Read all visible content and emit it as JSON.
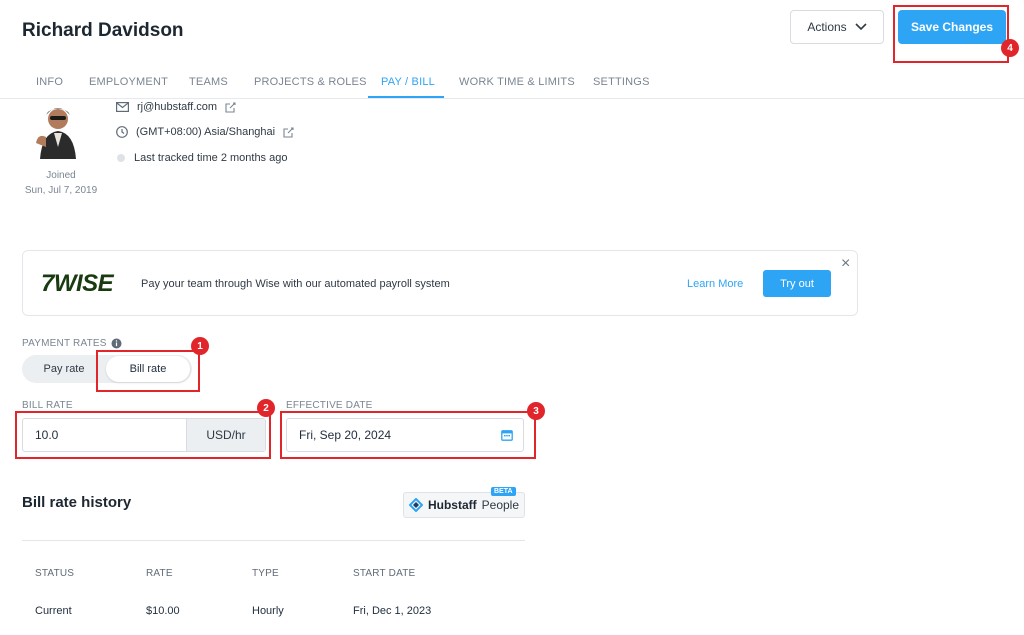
{
  "header": {
    "title": "Richard Davidson",
    "actions_label": "Actions",
    "save_label": "Save Changes"
  },
  "tabs": [
    {
      "label": "INFO"
    },
    {
      "label": "EMPLOYMENT"
    },
    {
      "label": "TEAMS"
    },
    {
      "label": "PROJECTS & ROLES"
    },
    {
      "label": "PAY / BILL",
      "active": true
    },
    {
      "label": "WORK TIME & LIMITS"
    },
    {
      "label": "SETTINGS"
    }
  ],
  "profile": {
    "email": "rj@hubstaff.com",
    "timezone": "(GMT+08:00) Asia/Shanghai",
    "last_tracked": "Last tracked time 2 months ago",
    "joined_label": "Joined",
    "joined_date": "Sun, Jul 7, 2019"
  },
  "wise_banner": {
    "logo": "7WISE",
    "text": "Pay your team through Wise with our automated payroll system",
    "learn_more": "Learn More",
    "try_out": "Try out",
    "close": "×"
  },
  "payment": {
    "section_label": "PAYMENT RATES",
    "pay_rate_label": "Pay rate",
    "bill_rate_label": "Bill rate",
    "bill_rate_field_label": "BILL RATE",
    "bill_rate_value": "10.0",
    "unit": "USD/hr",
    "effective_date_label": "EFFECTIVE DATE",
    "effective_date_value": "Fri, Sep 20, 2024"
  },
  "history": {
    "title": "Bill rate history",
    "brand": "Hubstaff",
    "brand_suffix": "People",
    "beta": "BETA",
    "columns": [
      "STATUS",
      "RATE",
      "TYPE",
      "START DATE"
    ],
    "rows": [
      [
        "Current",
        "$10.00",
        "Hourly",
        "Fri, Dec 1, 2023"
      ]
    ]
  },
  "annotations": [
    "1",
    "2",
    "3",
    "4"
  ],
  "colors": {
    "accent": "#2ea4f4",
    "highlight": "#e0262b",
    "wise_green": "#1a3b12"
  }
}
